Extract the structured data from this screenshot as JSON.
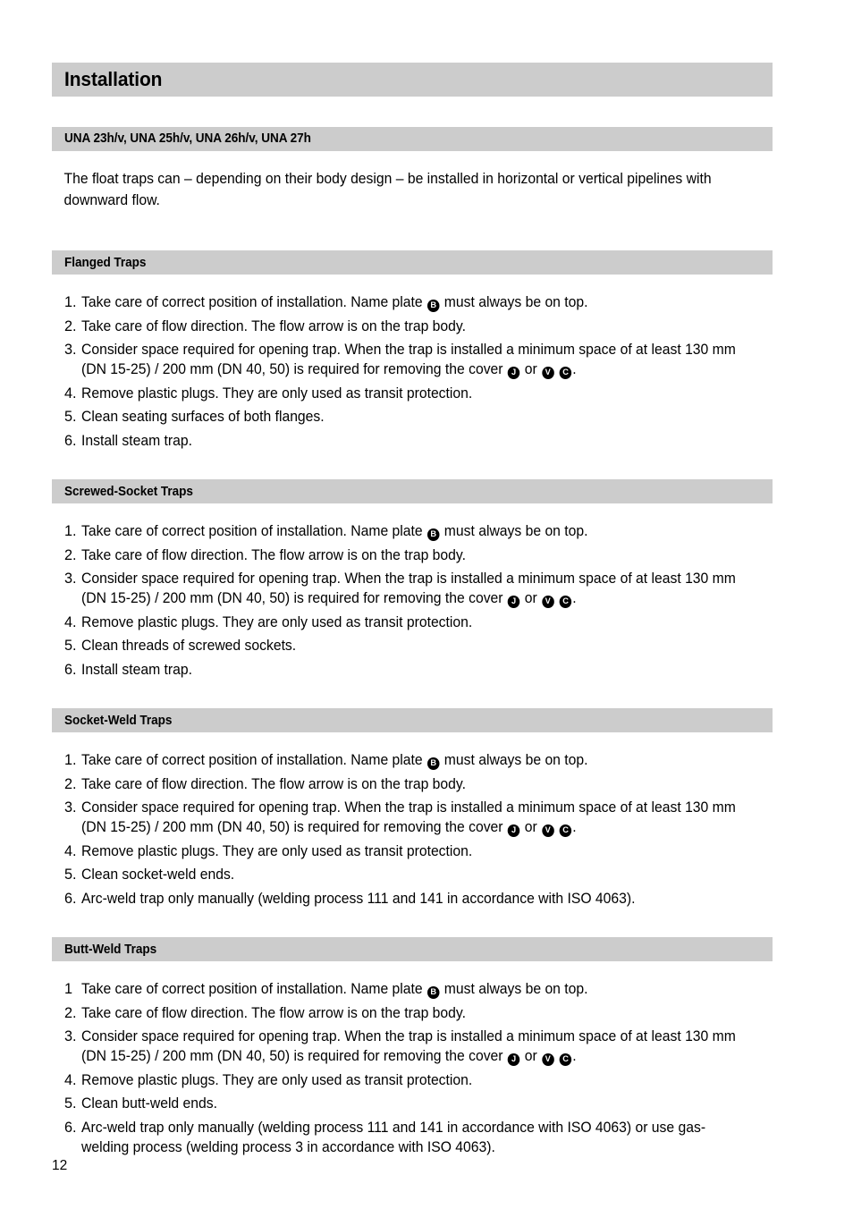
{
  "document": {
    "title": "Installation",
    "page_number": "12",
    "colors": {
      "header_bar": "#cccccc",
      "text": "#000000",
      "badge_fill": "#000000",
      "badge_text": "#ffffff",
      "background": "#ffffff"
    }
  },
  "model_section": {
    "heading": "UNA 23h/v, UNA 25h/v, UNA 26h/v, UNA 27h",
    "intro": "The float traps can – depending on their body design – be installed in horizontal or vertical pipelines with downward flow."
  },
  "badges": {
    "name_plate": "B",
    "cover_j": "J",
    "cover_v": "V",
    "cover_c": "C"
  },
  "sections": [
    {
      "heading": "Flanged Traps",
      "items": [
        {
          "number": "1.",
          "parts": [
            {
              "type": "text",
              "value": "Take care of correct position of installation. Name plate "
            },
            {
              "type": "badge",
              "value": "B"
            },
            {
              "type": "text",
              "value": " must always be on top."
            }
          ]
        },
        {
          "number": "2.",
          "parts": [
            {
              "type": "text",
              "value": "Take care of flow direction. The flow arrow is on the trap body."
            }
          ]
        },
        {
          "number": "3.",
          "parts": [
            {
              "type": "text",
              "value": "Consider space required for opening trap. When the trap is installed a minimum space of at least 130 mm (DN 15-25) / 200 mm (DN 40, 50) is required for removing the cover "
            },
            {
              "type": "badge",
              "value": "J"
            },
            {
              "type": "text",
              "value": " or "
            },
            {
              "type": "badge",
              "value": "V"
            },
            {
              "type": "text",
              "value": " "
            },
            {
              "type": "badge",
              "value": "C"
            },
            {
              "type": "text",
              "value": "."
            }
          ]
        },
        {
          "number": "4.",
          "parts": [
            {
              "type": "text",
              "value": "Remove plastic plugs. They are only used as transit protection."
            }
          ]
        },
        {
          "number": "5.",
          "parts": [
            {
              "type": "text",
              "value": "Clean seating surfaces of both flanges."
            }
          ]
        },
        {
          "number": "6.",
          "parts": [
            {
              "type": "text",
              "value": "Install steam trap."
            }
          ]
        }
      ]
    },
    {
      "heading": "Screwed-Socket Traps",
      "items": [
        {
          "number": "1.",
          "parts": [
            {
              "type": "text",
              "value": "Take care of correct position of installation. Name plate "
            },
            {
              "type": "badge",
              "value": "B"
            },
            {
              "type": "text",
              "value": " must always be on top."
            }
          ]
        },
        {
          "number": "2.",
          "parts": [
            {
              "type": "text",
              "value": "Take care of flow direction. The flow arrow is on the trap body."
            }
          ]
        },
        {
          "number": "3.",
          "parts": [
            {
              "type": "text",
              "value": "Consider space required for opening trap. When the trap is installed a minimum space of at least 130 mm (DN 15-25) / 200 mm (DN 40, 50) is required for removing the cover "
            },
            {
              "type": "badge",
              "value": "J"
            },
            {
              "type": "text",
              "value": " or "
            },
            {
              "type": "badge",
              "value": "V"
            },
            {
              "type": "text",
              "value": " "
            },
            {
              "type": "badge",
              "value": "C"
            },
            {
              "type": "text",
              "value": "."
            }
          ]
        },
        {
          "number": "4.",
          "parts": [
            {
              "type": "text",
              "value": "Remove plastic plugs. They are only used as transit protection."
            }
          ]
        },
        {
          "number": "5.",
          "parts": [
            {
              "type": "text",
              "value": "Clean threads of screwed sockets."
            }
          ]
        },
        {
          "number": "6.",
          "parts": [
            {
              "type": "text",
              "value": "Install steam trap."
            }
          ]
        }
      ]
    },
    {
      "heading": "Socket-Weld Traps",
      "items": [
        {
          "number": "1.",
          "parts": [
            {
              "type": "text",
              "value": "Take care of correct position of installation. Name plate "
            },
            {
              "type": "badge",
              "value": "B"
            },
            {
              "type": "text",
              "value": " must always be on top."
            }
          ]
        },
        {
          "number": "2.",
          "parts": [
            {
              "type": "text",
              "value": "Take care of flow direction. The flow arrow is on the trap body."
            }
          ]
        },
        {
          "number": "3.",
          "parts": [
            {
              "type": "text",
              "value": "Consider space required for opening trap. When the trap is installed a minimum space of at least 130 mm (DN 15-25) / 200 mm (DN 40, 50) is required for removing the cover "
            },
            {
              "type": "badge",
              "value": "J"
            },
            {
              "type": "text",
              "value": " or "
            },
            {
              "type": "badge",
              "value": "V"
            },
            {
              "type": "text",
              "value": " "
            },
            {
              "type": "badge",
              "value": "C"
            },
            {
              "type": "text",
              "value": "."
            }
          ]
        },
        {
          "number": "4.",
          "parts": [
            {
              "type": "text",
              "value": "Remove plastic plugs. They are only used as transit protection."
            }
          ]
        },
        {
          "number": "5.",
          "parts": [
            {
              "type": "text",
              "value": "Clean socket-weld ends."
            }
          ]
        },
        {
          "number": "6.",
          "parts": [
            {
              "type": "text",
              "value": "Arc-weld trap only manually (welding process 111 and 141 in accordance with ISO 4063)."
            }
          ]
        }
      ]
    },
    {
      "heading": "Butt-Weld Traps",
      "items": [
        {
          "number": "1",
          "parts": [
            {
              "type": "text",
              "value": "Take care of correct position of installation. Name plate "
            },
            {
              "type": "badge",
              "value": "B"
            },
            {
              "type": "text",
              "value": " must always be on top."
            }
          ]
        },
        {
          "number": "2.",
          "parts": [
            {
              "type": "text",
              "value": "Take care of flow direction. The flow arrow is on the trap body."
            }
          ]
        },
        {
          "number": "3.",
          "parts": [
            {
              "type": "text",
              "value": "Consider space required for opening trap. When the trap is installed a minimum space of at least 130 mm (DN 15-25) / 200 mm (DN 40, 50) is required for removing the cover "
            },
            {
              "type": "badge",
              "value": "J"
            },
            {
              "type": "text",
              "value": " or "
            },
            {
              "type": "badge",
              "value": "V"
            },
            {
              "type": "text",
              "value": " "
            },
            {
              "type": "badge",
              "value": "C"
            },
            {
              "type": "text",
              "value": "."
            }
          ]
        },
        {
          "number": "4.",
          "parts": [
            {
              "type": "text",
              "value": "Remove plastic plugs. They are only used as transit protection."
            }
          ]
        },
        {
          "number": "5.",
          "parts": [
            {
              "type": "text",
              "value": "Clean butt-weld ends."
            }
          ]
        },
        {
          "number": "6.",
          "parts": [
            {
              "type": "text",
              "value": "Arc-weld trap only manually (welding process 111 and 141 in accordance with ISO 4063) or use gas-welding process (welding process 3 in accordance with ISO 4063)."
            }
          ]
        }
      ]
    }
  ]
}
